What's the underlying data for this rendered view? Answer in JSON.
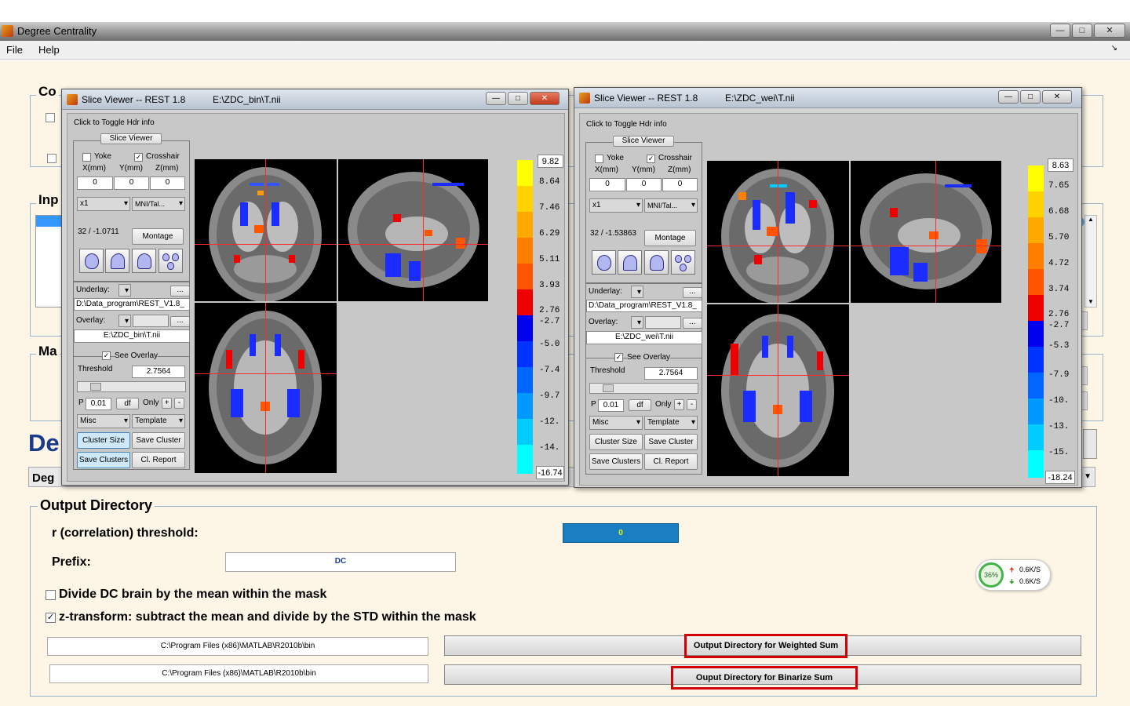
{
  "window": {
    "title": "Degree Centrality",
    "menu": [
      "File",
      "Help"
    ]
  },
  "bg_panels": {
    "config_title": "Co",
    "input_title": "Inp",
    "mask_title": "Ma",
    "big_title": "De",
    "dropdown_title": "Deg"
  },
  "output": {
    "title": "Output Directory",
    "r_label": "r (correlation) threshold:",
    "r_value": "0",
    "prefix_label": "Prefix:",
    "prefix_value": "DC",
    "divide_label": "Divide DC brain by the mean within the mask",
    "divide_checked": false,
    "ztrans_label": "z-transform: subtract the mean and divide by the STD within the mask",
    "ztrans_checked": true,
    "dir1_value": "C:\\Program Files (x86)\\MATLAB\\R2010b\\bin",
    "dir2_value": "C:\\Program Files (x86)\\MATLAB\\R2010b\\bin",
    "btn_weighted": "Output Directory for Weighted Sum",
    "btn_binarize": "Ouput Directory for Binarize Sum"
  },
  "network": {
    "percent": "36%",
    "up": "0.6K/S",
    "down": "0.6K/S"
  },
  "viewers": [
    {
      "title": "Slice Viewer -- REST 1.8",
      "path": "E:\\ZDC_bin\\T.nii",
      "toggle_hdr": "Click to Toggle Hdr info",
      "slice_viewer_label": "Slice Viewer",
      "yoke": "Yoke",
      "crosshair": "Crosshair",
      "x_label": "X(mm)",
      "y_label": "Y(mm)",
      "z_label": "Z(mm)",
      "x_val": "0",
      "y_val": "0",
      "z_val": "0",
      "zoom": "x1",
      "space": "MNI/Tal...",
      "intensity": "32 / -1.0711",
      "montage": "Montage",
      "underlay_label": "Underlay:",
      "underlay_path": "D:\\Data_program\\REST_V1.8_",
      "overlay_label": "Overlay:",
      "overlay_file": "E:\\ZDC_bin\\T.nii",
      "see_overlay": "See Overlay",
      "threshold_label": "Threshold",
      "threshold_val": "2.7564",
      "p_label": "P",
      "p_val": "0.01",
      "df": "df",
      "only": "Only",
      "plus": "+",
      "minus": "-",
      "misc": "Misc",
      "template": "Template",
      "cluster_size": "Cluster Size",
      "save_cluster": "Save Cluster",
      "save_clusters": "Save Clusters",
      "cl_report": "Cl. Report",
      "dots": "...",
      "cbar_max": "9.82",
      "cbar_min": "-16.74",
      "cbar_labels": [
        "8.64",
        "7.46",
        "6.29",
        "5.11",
        "3.93",
        "2.76",
        "-2.7",
        "-5.0",
        "-7.4",
        "-9.7",
        "-12.",
        "-14."
      ]
    },
    {
      "title": "Slice Viewer -- REST 1.8",
      "path": "E:\\ZDC_wei\\T.nii",
      "toggle_hdr": "Click to Toggle Hdr info",
      "slice_viewer_label": "Slice Viewer",
      "yoke": "Yoke",
      "crosshair": "Crosshair",
      "x_label": "X(mm)",
      "y_label": "Y(mm)",
      "z_label": "Z(mm)",
      "x_val": "0",
      "y_val": "0",
      "z_val": "0",
      "zoom": "x1",
      "space": "MNI/Tal...",
      "intensity": "32 / -1.53863",
      "montage": "Montage",
      "underlay_label": "Underlay:",
      "underlay_path": "D:\\Data_program\\REST_V1.8_",
      "overlay_label": "Overlay:",
      "overlay_file": "E:\\ZDC_wei\\T.nii",
      "see_overlay": "See Overlay",
      "threshold_label": "Threshold",
      "threshold_val": "2.7564",
      "p_label": "P",
      "p_val": "0.01",
      "df": "df",
      "only": "Only",
      "plus": "+",
      "minus": "-",
      "misc": "Misc",
      "template": "Template",
      "cluster_size": "Cluster Size",
      "save_cluster": "Save Cluster",
      "save_clusters": "Save Clusters",
      "cl_report": "Cl. Report",
      "dots": "...",
      "cbar_max": "8.63",
      "cbar_min": "-18.24",
      "cbar_labels": [
        "7.65",
        "6.68",
        "5.70",
        "4.72",
        "3.74",
        "2.76",
        "-2.7",
        "-5.3",
        "-7.9",
        "-10.",
        "-13.",
        "-15."
      ]
    }
  ],
  "colors": {
    "pos_scale": [
      "#ffff00",
      "#ffd200",
      "#ffa800",
      "#ff7e00",
      "#ff5400",
      "#ff2a00",
      "#ee0000"
    ],
    "neg_scale": [
      "#0000ee",
      "#0033ff",
      "#0066ff",
      "#0099ff",
      "#00ccff",
      "#00ffff"
    ],
    "highlight": "#d20000",
    "accent_bar": "#1a7fc2"
  }
}
